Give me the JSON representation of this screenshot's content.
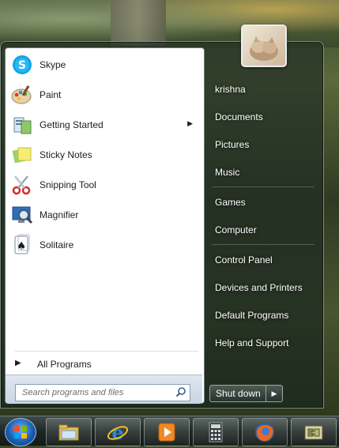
{
  "programs": [
    {
      "label": "Skype",
      "icon": "skype-icon",
      "has_submenu": false
    },
    {
      "label": "Paint",
      "icon": "paint-icon",
      "has_submenu": false
    },
    {
      "label": "Getting Started",
      "icon": "getting-started-icon",
      "has_submenu": true
    },
    {
      "label": "Sticky Notes",
      "icon": "sticky-notes-icon",
      "has_submenu": false
    },
    {
      "label": "Snipping Tool",
      "icon": "snipping-tool-icon",
      "has_submenu": false
    },
    {
      "label": "Magnifier",
      "icon": "magnifier-icon",
      "has_submenu": false
    },
    {
      "label": "Solitaire",
      "icon": "solitaire-icon",
      "has_submenu": false
    }
  ],
  "all_programs_label": "All Programs",
  "search": {
    "placeholder": "Search programs and files"
  },
  "right_pane": {
    "items": [
      {
        "label": "krishna"
      },
      {
        "label": "Documents"
      },
      {
        "label": "Pictures"
      },
      {
        "label": "Music"
      },
      {
        "label": "Games"
      },
      {
        "label": "Computer"
      },
      {
        "label": "Control Panel"
      },
      {
        "label": "Devices and Printers"
      },
      {
        "label": "Default Programs"
      },
      {
        "label": "Help and Support"
      }
    ]
  },
  "shutdown": {
    "label": "Shut down"
  },
  "taskbar": {
    "buttons": [
      {
        "icon": "windows-explorer-icon"
      },
      {
        "icon": "internet-explorer-icon"
      },
      {
        "icon": "media-player-icon"
      },
      {
        "icon": "calculator-icon"
      },
      {
        "icon": "firefox-icon"
      },
      {
        "icon": "puzzle-app-icon"
      }
    ]
  },
  "colors": {
    "accent": "#1b5fb5",
    "menu_text_light": "#ffffff",
    "menu_text_dark": "#1e1e1e"
  }
}
